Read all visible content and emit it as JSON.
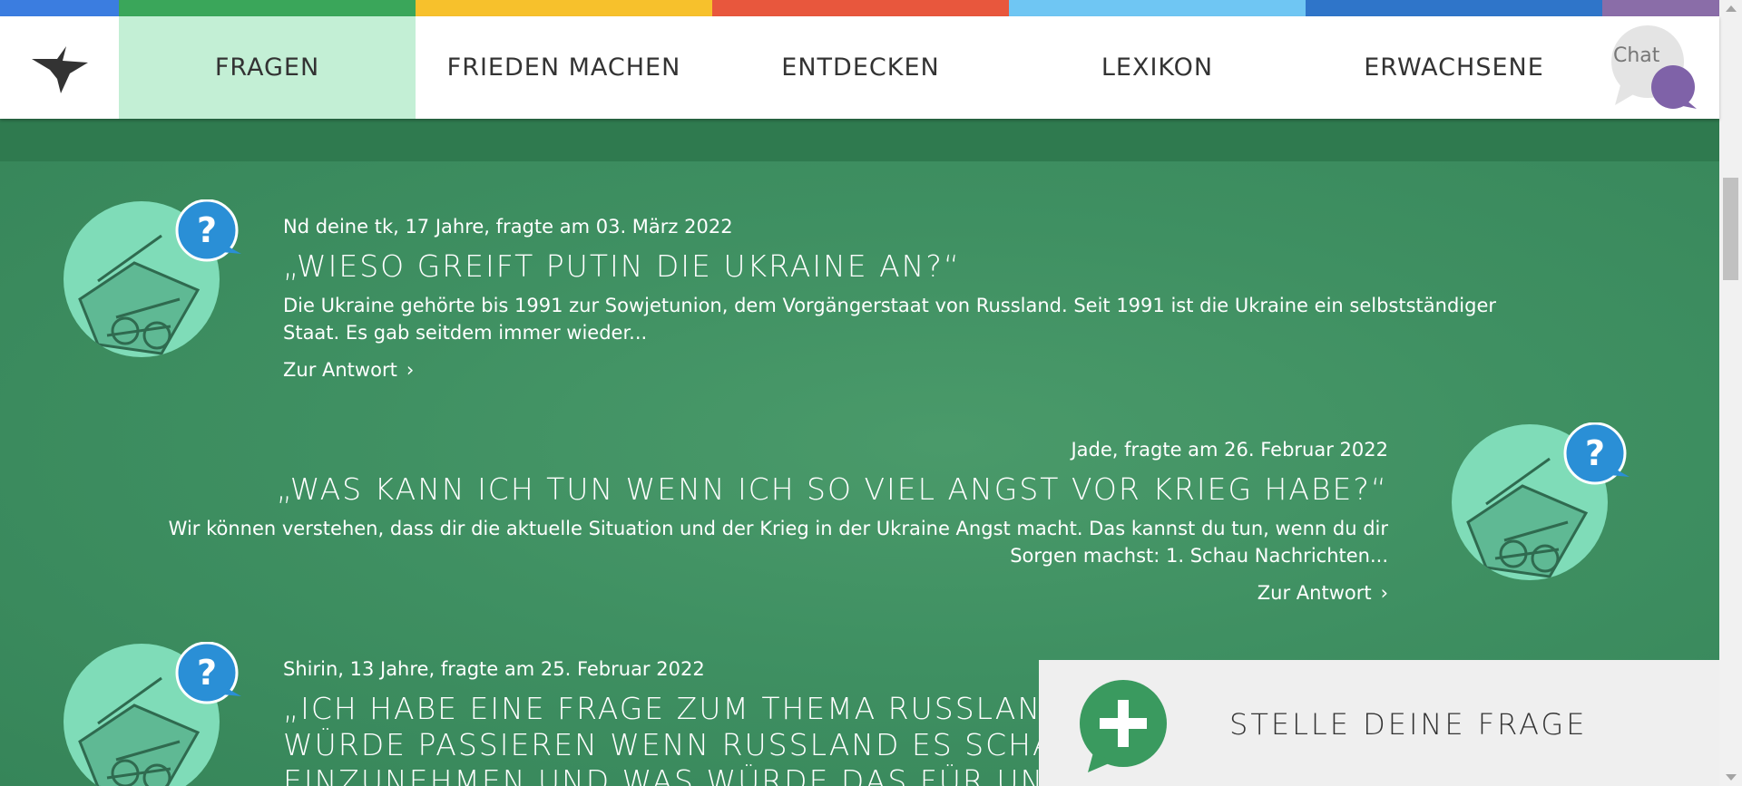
{
  "header": {
    "nav": [
      {
        "label": "FRAGEN",
        "active": true
      },
      {
        "label": "FRIEDEN MACHEN",
        "active": false
      },
      {
        "label": "ENTDECKEN",
        "active": false
      },
      {
        "label": "LEXIKON",
        "active": false
      },
      {
        "label": "ERWACHSENE",
        "active": false
      }
    ],
    "chat_label": "Chat",
    "strip_colors": [
      "#3b7de0",
      "#3aa65a",
      "#f7c12c",
      "#e8573d",
      "#6fc6f3",
      "#2f75c9",
      "#8a6da8"
    ]
  },
  "questions": [
    {
      "meta": "Nd deine tk, 17 Jahre, fragte am 03. März 2022",
      "title": "„WIESO GREIFT PUTIN DIE UKRAINE AN?“",
      "excerpt_line1": "Die Ukraine gehörte bis 1991 zur Sowjetunion, dem Vorgängerstaat von Russland. Seit 1991 ist die Ukraine ein selbstständiger",
      "excerpt_line2": "Staat. Es gab seitdem immer wieder...",
      "link": "Zur Antwort"
    },
    {
      "meta": "Jade, fragte am 26. Februar 2022",
      "title": "„WAS KANN ICH TUN WENN ICH SO VIEL ANGST VOR KRIEG HABE?“",
      "excerpt_line1": "Wir können verstehen, dass dir die aktuelle Situation und der Krieg in der Ukraine Angst macht. Das kannst du tun, wenn du dir",
      "excerpt_line2": "Sorgen machst: 1. Schau Nachrichten...",
      "link": "Zur Antwort"
    },
    {
      "meta": "Shirin, 13 Jahre, fragte am 25. Februar 2022",
      "title_line1": "„ICH HABE EINE FRAGE ZUM THEMA RUSSLAND",
      "title_line2": "WÜRDE PASSIEREN WENN RUSSLAND ES SCHAFF",
      "title_line3": "EINZUNEHMEN UND WAS WÜRDE DAS FÜR UNS B"
    }
  ],
  "ask": {
    "label": "STELLE DEINE FRAGE"
  },
  "colors": {
    "accent_green": "#3a8c5f",
    "nav_active": "#c3efd5",
    "bubble_blue": "#2a8fd6"
  }
}
